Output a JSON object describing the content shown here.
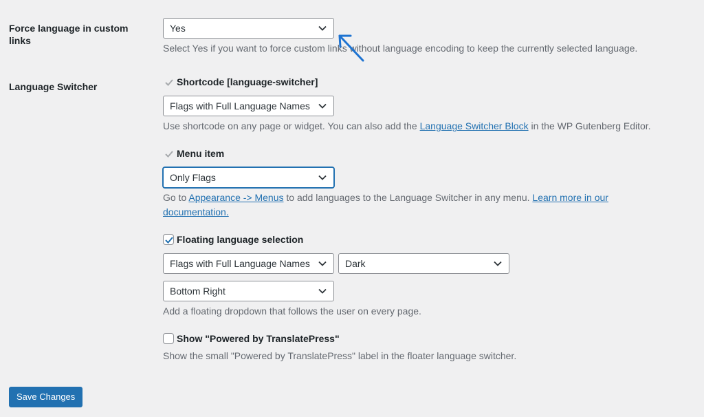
{
  "force_language": {
    "label": "Force language in custom links",
    "select_value": "Yes",
    "description": "Select Yes if you want to force custom links without language encoding to keep the currently selected language."
  },
  "language_switcher": {
    "label": "Language Switcher",
    "shortcode": {
      "checkbox_label": "Shortcode [language-switcher]",
      "checked": true,
      "disabled": true,
      "select_value": "Flags with Full Language Names",
      "desc_pre": "Use shortcode on any page or widget. You can also add the ",
      "desc_link": "Language Switcher Block",
      "desc_post": " in the WP Gutenberg Editor."
    },
    "menu_item": {
      "checkbox_label": "Menu item",
      "checked": true,
      "disabled": true,
      "select_value": "Only Flags",
      "desc_pre": "Go to ",
      "desc_link1": "Appearance -> Menus",
      "desc_mid": " to add languages to the Language Switcher in any menu. ",
      "desc_link2_line1": "Learn more in our",
      "desc_link2_line2": "documentation."
    },
    "floating": {
      "checkbox_label": "Floating language selection",
      "checked": true,
      "select_style": "Flags with Full Language Names",
      "select_theme": "Dark",
      "select_position": "Bottom Right",
      "description": "Add a floating dropdown that follows the user on every page."
    },
    "powered_by": {
      "checkbox_label": "Show \"Powered by TranslatePress\"",
      "checked": false,
      "description": "Show the small \"Powered by TranslatePress\" label in the floater language switcher."
    }
  },
  "save_button": "Save Changes",
  "colors": {
    "accent": "#2271b1",
    "annotation_arrow": "#1e73d1",
    "background": "#f0f0f1"
  }
}
